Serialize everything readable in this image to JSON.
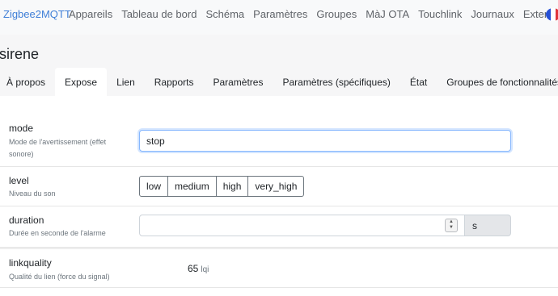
{
  "navbar": {
    "brand": "Zigbee2MQTT",
    "links": [
      "Appareils",
      "Tableau de bord",
      "Schéma",
      "Paramètres",
      "Groupes",
      "MàJ OTA",
      "Touchlink",
      "Journaux",
      "Extensions"
    ],
    "language_flag": "flag-fr-icon"
  },
  "device": {
    "title": "sirene"
  },
  "tabs": [
    "À propos",
    "Expose",
    "Lien",
    "Rapports",
    "Paramètres",
    "Paramètres (spécifiques)",
    "État",
    "Groupes de fonctionnalités"
  ],
  "active_tab": "Expose",
  "expose": {
    "mode": {
      "label": "mode",
      "description": "Mode de l'avertissement (effet sonore)",
      "value": "stop"
    },
    "level": {
      "label": "level",
      "description": "Niveau du son",
      "options": [
        "low",
        "medium",
        "high",
        "very_high"
      ]
    },
    "duration": {
      "label": "duration",
      "description": "Durée en seconde de l'alarme",
      "value": "",
      "unit": "s"
    },
    "linkquality": {
      "label": "linkquality",
      "description": "Qualité du lien (force du signal)",
      "value": "65",
      "unit": "lqi"
    }
  },
  "colors": {
    "brand": "#3f7fd7",
    "input_focus": "#86b7fe",
    "muted_text": "#6c757d"
  }
}
